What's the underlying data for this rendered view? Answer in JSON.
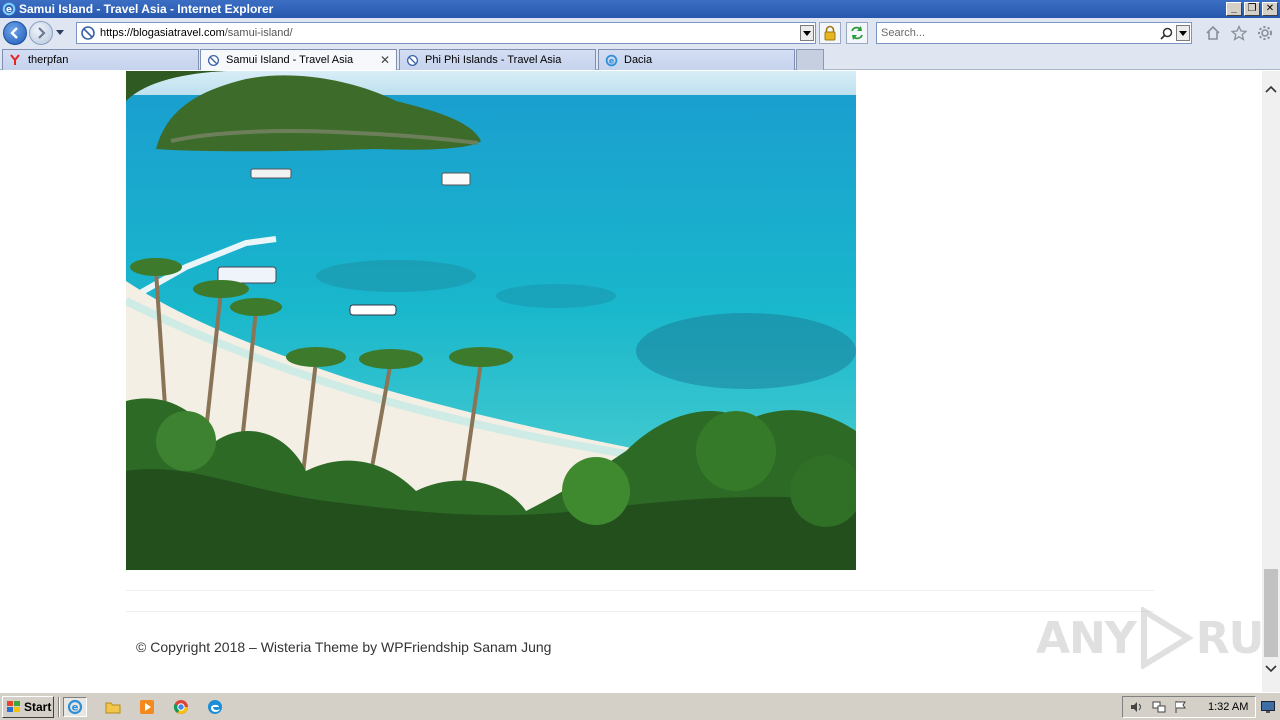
{
  "window": {
    "title": "Samui Island - Travel Asia - Internet Explorer",
    "controls": {
      "minimize": "_",
      "restore": "❐",
      "close": "✕"
    }
  },
  "address_bar": {
    "url_host": "https://blogasiatravel.com",
    "url_path": "/samui-island/"
  },
  "search": {
    "placeholder": "Search..."
  },
  "tabs": [
    {
      "label": "therpfan",
      "icon": "yandex-icon",
      "active": false
    },
    {
      "label": "Samui Island - Travel Asia",
      "icon": "blocked-page-icon",
      "active": true,
      "close": "✕"
    },
    {
      "label": "Phi Phi Islands - Travel Asia",
      "icon": "blocked-page-icon",
      "active": false
    },
    {
      "label": "Dacia",
      "icon": "ie-icon",
      "active": false
    }
  ],
  "page": {
    "image_alt": "samui-island-beach-photo",
    "copyright": "© Copyright 2018 – Wisteria Theme by WPFriendship Sanam Jung"
  },
  "watermark": {
    "left": "ANY",
    "right": "RUN"
  },
  "taskbar": {
    "start_label": "Start",
    "clock": "1:32 AM"
  },
  "colors": {
    "titlebar": "#2758ae",
    "chrome": "#dfe6f1",
    "taskbar": "#d4d0c8",
    "sea": "#1fb8c9",
    "sand": "#f2efe6"
  }
}
